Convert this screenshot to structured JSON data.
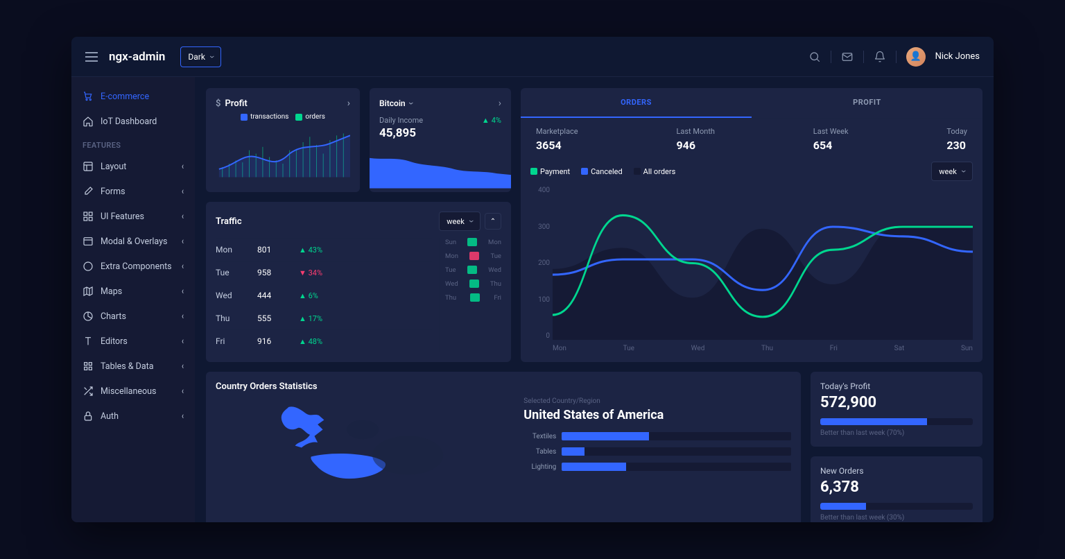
{
  "header": {
    "brand": "ngx-admin",
    "theme": "Dark",
    "user": "Nick Jones"
  },
  "sidebar": {
    "top": [
      {
        "label": "E-commerce",
        "icon": "cart",
        "active": true
      },
      {
        "label": "IoT Dashboard",
        "icon": "home"
      }
    ],
    "featuresHeader": "FEATURES",
    "features": [
      {
        "label": "Layout",
        "icon": "layout"
      },
      {
        "label": "Forms",
        "icon": "edit"
      },
      {
        "label": "UI Features",
        "icon": "grid"
      },
      {
        "label": "Modal & Overlays",
        "icon": "browser"
      },
      {
        "label": "Extra Components",
        "icon": "message"
      },
      {
        "label": "Maps",
        "icon": "map"
      },
      {
        "label": "Charts",
        "icon": "pie"
      },
      {
        "label": "Editors",
        "icon": "text"
      },
      {
        "label": "Tables & Data",
        "icon": "tables"
      },
      {
        "label": "Miscellaneous",
        "icon": "shuffle"
      },
      {
        "label": "Auth",
        "icon": "lock"
      }
    ]
  },
  "profit": {
    "title": "Profit",
    "legend": [
      {
        "label": "transactions",
        "color": "#3366ff"
      },
      {
        "label": "orders",
        "color": "#00d68f"
      }
    ]
  },
  "bitcoin": {
    "currency": "Bitcoin",
    "dailyLabel": "Daily Income",
    "value": "45,895",
    "delta": "4%"
  },
  "orders": {
    "tabs": [
      "ORDERS",
      "PROFIT"
    ],
    "activeTab": 0,
    "metrics": [
      {
        "label": "Marketplace",
        "value": "3654"
      },
      {
        "label": "Last Month",
        "value": "946"
      },
      {
        "label": "Last Week",
        "value": "654"
      },
      {
        "label": "Today",
        "value": "230"
      }
    ],
    "legend": [
      {
        "label": "Payment",
        "color": "#00d68f"
      },
      {
        "label": "Canceled",
        "color": "#3366ff"
      },
      {
        "label": "All orders",
        "color": "#151a34"
      }
    ],
    "period": "week"
  },
  "chart_data": {
    "type": "line",
    "title": "Orders",
    "xlabel": "",
    "ylabel": "",
    "ylim": [
      0,
      400
    ],
    "yticks": [
      0,
      100,
      200,
      300,
      400
    ],
    "categories": [
      "Mon",
      "Tue",
      "Wed",
      "Thu",
      "Fri",
      "Sat",
      "Sun"
    ],
    "series": [
      {
        "name": "All orders",
        "values": [
          185,
          240,
          110,
          290,
          145,
          300,
          300
        ]
      },
      {
        "name": "Canceled",
        "values": [
          170,
          210,
          210,
          130,
          295,
          270,
          230
        ]
      },
      {
        "name": "Payment",
        "values": [
          65,
          325,
          200,
          60,
          235,
          295,
          295
        ]
      }
    ]
  },
  "traffic": {
    "title": "Traffic",
    "period": "week",
    "rows": [
      {
        "day": "Mon",
        "value": "801",
        "delta": "43%",
        "dir": "up"
      },
      {
        "day": "Tue",
        "value": "958",
        "delta": "34%",
        "dir": "down"
      },
      {
        "day": "Wed",
        "value": "444",
        "delta": "6%",
        "dir": "up"
      },
      {
        "day": "Thu",
        "value": "555",
        "delta": "17%",
        "dir": "up"
      },
      {
        "day": "Fri",
        "value": "916",
        "delta": "48%",
        "dir": "up"
      }
    ],
    "mini": [
      {
        "a": "Sun",
        "b": "Mon",
        "c": "#00d68f"
      },
      {
        "a": "Mon",
        "b": "Tue",
        "c": "#ff3d71"
      },
      {
        "a": "Tue",
        "b": "Wed",
        "c": "#00d68f"
      },
      {
        "a": "Wed",
        "b": "Thu",
        "c": "#00d68f"
      },
      {
        "a": "Thu",
        "b": "Fri",
        "c": "#00d68f"
      }
    ]
  },
  "country": {
    "title": "Country Orders Statistics",
    "selectedLabel": "Selected Country/Region",
    "selected": "United States of America",
    "bars": [
      {
        "label": "Textiles",
        "pct": 38
      },
      {
        "label": "Tables",
        "pct": 10
      },
      {
        "label": "Lighting",
        "pct": 28
      }
    ]
  },
  "sideStats": [
    {
      "label": "Today's Profit",
      "value": "572,900",
      "pct": 70,
      "note": "Better than last week (70%)"
    },
    {
      "label": "New Orders",
      "value": "6,378",
      "pct": 30,
      "note": "Better than last week (30%)"
    }
  ]
}
